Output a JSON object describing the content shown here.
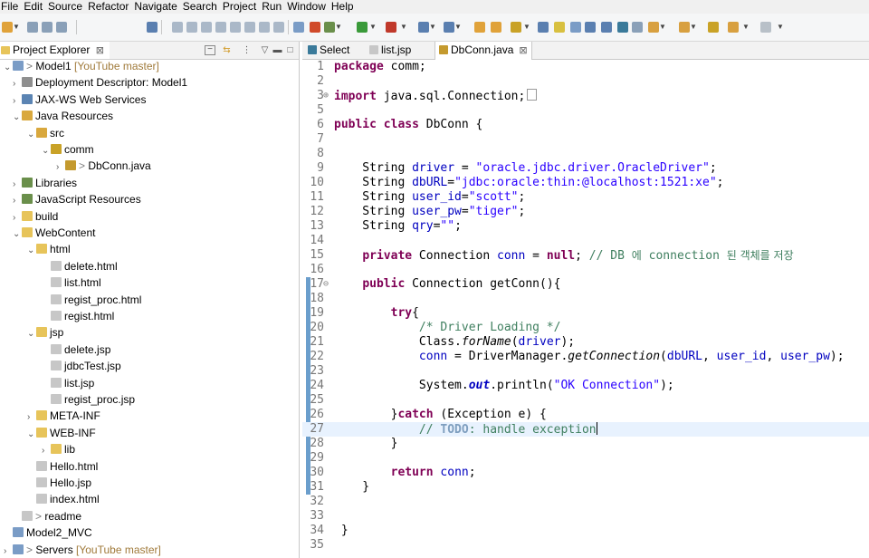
{
  "menu": [
    "File",
    "Edit",
    "Source",
    "Refactor",
    "Navigate",
    "Search",
    "Project",
    "Run",
    "Window",
    "Help"
  ],
  "explorer": {
    "title": "Project Explorer",
    "tree": [
      {
        "name": "Model1",
        "decoration": "[YouTube master]",
        "prefix": "> ",
        "twisty": "v",
        "icon": "project-icon",
        "color": "#7a9cc6"
      },
      {
        "name": "Deployment Descriptor: Model1",
        "decoration": "",
        "prefix": "",
        "twisty": ">",
        "icon": "deployment-descriptor-icon",
        "color": "#8f8f8f"
      },
      {
        "name": "JAX-WS Web Services",
        "decoration": "",
        "prefix": "",
        "twisty": ">",
        "icon": "web-services-icon",
        "color": "#5b84b3"
      },
      {
        "name": "Java Resources",
        "decoration": "",
        "prefix": "",
        "twisty": "v",
        "icon": "java-resources-icon",
        "color": "#d9a83d"
      },
      {
        "name": "src",
        "decoration": "",
        "prefix": "",
        "twisty": "v",
        "icon": "source-folder-icon",
        "color": "#d9a83d"
      },
      {
        "name": "comm",
        "decoration": "",
        "prefix": "",
        "twisty": "v",
        "icon": "package-icon",
        "color": "#c9a227"
      },
      {
        "name": "DbConn.java",
        "decoration": "",
        "prefix": "> ",
        "twisty": ">",
        "icon": "java-file-icon",
        "color": "#c49a2e"
      },
      {
        "name": "Libraries",
        "decoration": "",
        "prefix": "",
        "twisty": ">",
        "icon": "libraries-icon",
        "color": "#6a8f4b"
      },
      {
        "name": "JavaScript Resources",
        "decoration": "",
        "prefix": "",
        "twisty": ">",
        "icon": "javascript-resources-icon",
        "color": "#6a8f4b"
      },
      {
        "name": "build",
        "decoration": "",
        "prefix": "",
        "twisty": ">",
        "icon": "folder-icon",
        "color": "#e7c45a"
      },
      {
        "name": "WebContent",
        "decoration": "",
        "prefix": "",
        "twisty": "v",
        "icon": "folder-icon",
        "color": "#e7c45a"
      },
      {
        "name": "html",
        "decoration": "",
        "prefix": "",
        "twisty": "v",
        "icon": "folder-icon",
        "color": "#e7c45a"
      },
      {
        "name": "delete.html",
        "decoration": "",
        "prefix": "",
        "twisty": "",
        "icon": "file-icon",
        "color": "#c7c7c7"
      },
      {
        "name": "list.html",
        "decoration": "",
        "prefix": "",
        "twisty": "",
        "icon": "file-icon",
        "color": "#c7c7c7"
      },
      {
        "name": "regist_proc.html",
        "decoration": "",
        "prefix": "",
        "twisty": "",
        "icon": "file-icon",
        "color": "#c7c7c7"
      },
      {
        "name": "regist.html",
        "decoration": "",
        "prefix": "",
        "twisty": "",
        "icon": "file-icon",
        "color": "#c7c7c7"
      },
      {
        "name": "jsp",
        "decoration": "",
        "prefix": "",
        "twisty": "v",
        "icon": "folder-icon",
        "color": "#e7c45a"
      },
      {
        "name": "delete.jsp",
        "decoration": "",
        "prefix": "",
        "twisty": "",
        "icon": "file-icon",
        "color": "#c7c7c7"
      },
      {
        "name": "jdbcTest.jsp",
        "decoration": "",
        "prefix": "",
        "twisty": "",
        "icon": "file-icon",
        "color": "#c7c7c7"
      },
      {
        "name": "list.jsp",
        "decoration": "",
        "prefix": "",
        "twisty": "",
        "icon": "file-icon",
        "color": "#c7c7c7"
      },
      {
        "name": "regist_proc.jsp",
        "decoration": "",
        "prefix": "",
        "twisty": "",
        "icon": "file-icon",
        "color": "#c7c7c7"
      },
      {
        "name": "META-INF",
        "decoration": "",
        "prefix": "",
        "twisty": ">",
        "icon": "folder-icon",
        "color": "#e7c45a"
      },
      {
        "name": "WEB-INF",
        "decoration": "",
        "prefix": "",
        "twisty": "v",
        "icon": "folder-icon",
        "color": "#e7c45a"
      },
      {
        "name": "lib",
        "decoration": "",
        "prefix": "",
        "twisty": ">",
        "icon": "folder-icon",
        "color": "#e7c45a"
      },
      {
        "name": "Hello.html",
        "decoration": "",
        "prefix": "",
        "twisty": "",
        "icon": "file-icon",
        "color": "#c7c7c7"
      },
      {
        "name": "Hello.jsp",
        "decoration": "",
        "prefix": "",
        "twisty": "",
        "icon": "file-icon",
        "color": "#c7c7c7"
      },
      {
        "name": "index.html",
        "decoration": "",
        "prefix": "",
        "twisty": "",
        "icon": "file-icon",
        "color": "#c7c7c7"
      },
      {
        "name": "readme",
        "decoration": "",
        "prefix": "> ",
        "twisty": "",
        "icon": "file-icon",
        "color": "#c7c7c7"
      },
      {
        "name": "Model2_MVC",
        "decoration": "",
        "prefix": "",
        "twisty": "",
        "icon": "closed-project-icon",
        "color": "#7a9cc6"
      },
      {
        "name": "Servers",
        "decoration": "[YouTube master]",
        "prefix": "> ",
        "twisty": ">",
        "icon": "servers-project-icon",
        "color": "#7a9cc6"
      }
    ]
  },
  "editor": {
    "tabs": [
      {
        "label": "Select",
        "icon": "web-browser-icon",
        "active": false
      },
      {
        "label": "list.jsp",
        "icon": "jsp-file-icon",
        "active": false
      },
      {
        "label": "DbConn.java",
        "icon": "java-file-icon",
        "active": true
      }
    ],
    "close_glyph": "⊠",
    "current_line": 27,
    "lines": [
      {
        "n": "1",
        "tokens": [
          {
            "t": "package",
            "c": "kw"
          },
          {
            "t": " comm;"
          }
        ]
      },
      {
        "n": "2",
        "tokens": []
      },
      {
        "n": "3",
        "fold": "⊕",
        "tokens": [
          {
            "t": "import",
            "c": "kw"
          },
          {
            "t": " java.sql.Connection;"
          }
        ],
        "collapsed": true
      },
      {
        "n": "5",
        "tokens": []
      },
      {
        "n": "6",
        "tokens": [
          {
            "t": "public",
            "c": "kw"
          },
          {
            "t": " "
          },
          {
            "t": "class",
            "c": "kw"
          },
          {
            "t": " DbConn {"
          }
        ]
      },
      {
        "n": "7",
        "tokens": []
      },
      {
        "n": "8",
        "tokens": []
      },
      {
        "n": "9",
        "tokens": [
          {
            "t": "    String "
          },
          {
            "t": "driver",
            "c": "fld"
          },
          {
            "t": " = "
          },
          {
            "t": "\"oracle.jdbc.driver.OracleDriver\"",
            "c": "str"
          },
          {
            "t": ";"
          }
        ]
      },
      {
        "n": "10",
        "tokens": [
          {
            "t": "    String "
          },
          {
            "t": "dbURL",
            "c": "fld"
          },
          {
            "t": "="
          },
          {
            "t": "\"jdbc:oracle:thin:@localhost:1521:xe\"",
            "c": "str"
          },
          {
            "t": ";"
          }
        ]
      },
      {
        "n": "11",
        "tokens": [
          {
            "t": "    String "
          },
          {
            "t": "user_id",
            "c": "fld"
          },
          {
            "t": "="
          },
          {
            "t": "\"scott\"",
            "c": "str"
          },
          {
            "t": ";"
          }
        ]
      },
      {
        "n": "12",
        "tokens": [
          {
            "t": "    String "
          },
          {
            "t": "user_pw",
            "c": "fld"
          },
          {
            "t": "="
          },
          {
            "t": "\"tiger\"",
            "c": "str"
          },
          {
            "t": ";"
          }
        ]
      },
      {
        "n": "13",
        "tokens": [
          {
            "t": "    String "
          },
          {
            "t": "qry",
            "c": "fld"
          },
          {
            "t": "="
          },
          {
            "t": "\"\"",
            "c": "str"
          },
          {
            "t": ";"
          }
        ]
      },
      {
        "n": "14",
        "tokens": []
      },
      {
        "n": "15",
        "tokens": [
          {
            "t": "    "
          },
          {
            "t": "private",
            "c": "kw"
          },
          {
            "t": " Connection "
          },
          {
            "t": "conn",
            "c": "fld"
          },
          {
            "t": " = "
          },
          {
            "t": "null",
            "c": "kw"
          },
          {
            "t": "; "
          },
          {
            "t": "// DB ",
            "c": "cmt"
          },
          {
            "t": "에",
            "c": "cmt ko"
          },
          {
            "t": " connection ",
            "c": "cmt"
          },
          {
            "t": "된 객체를 저장",
            "c": "cmt ko"
          }
        ]
      },
      {
        "n": "16",
        "tokens": []
      },
      {
        "n": "17",
        "fold": "⊖",
        "tokens": [
          {
            "t": "    "
          },
          {
            "t": "public",
            "c": "kw"
          },
          {
            "t": " Connection getConn(){"
          }
        ],
        "marker": true
      },
      {
        "n": "18",
        "tokens": [],
        "marker": true
      },
      {
        "n": "19",
        "tokens": [
          {
            "t": "        "
          },
          {
            "t": "try",
            "c": "kw"
          },
          {
            "t": "{"
          }
        ],
        "marker": true
      },
      {
        "n": "20",
        "tokens": [
          {
            "t": "            "
          },
          {
            "t": "/* Driver Loading */",
            "c": "cmt"
          }
        ],
        "marker": true
      },
      {
        "n": "21",
        "tokens": [
          {
            "t": "            Class."
          },
          {
            "t": "forName",
            "c": "it"
          },
          {
            "t": "("
          },
          {
            "t": "driver",
            "c": "fld"
          },
          {
            "t": ");"
          }
        ],
        "marker": true
      },
      {
        "n": "22",
        "tokens": [
          {
            "t": "            "
          },
          {
            "t": "conn",
            "c": "fld"
          },
          {
            "t": " = DriverManager."
          },
          {
            "t": "getConnection",
            "c": "it"
          },
          {
            "t": "("
          },
          {
            "t": "dbURL",
            "c": "fld"
          },
          {
            "t": ", "
          },
          {
            "t": "user_id",
            "c": "fld"
          },
          {
            "t": ", "
          },
          {
            "t": "user_pw",
            "c": "fld"
          },
          {
            "t": ");"
          }
        ],
        "marker": true
      },
      {
        "n": "23",
        "tokens": [],
        "marker": true
      },
      {
        "n": "24",
        "tokens": [
          {
            "t": "            System."
          },
          {
            "t": "out",
            "c": "stat"
          },
          {
            "t": ".println("
          },
          {
            "t": "\"OK Connection\"",
            "c": "str"
          },
          {
            "t": ");"
          }
        ],
        "marker": true
      },
      {
        "n": "25",
        "tokens": [],
        "marker": true
      },
      {
        "n": "26",
        "tokens": [
          {
            "t": "        }"
          },
          {
            "t": "catch",
            "c": "kw"
          },
          {
            "t": " (Exception e) {"
          }
        ],
        "marker": true
      },
      {
        "n": "27",
        "tokens": [
          {
            "t": "            "
          },
          {
            "t": "// ",
            "c": "cmt"
          },
          {
            "t": "TODO",
            "c": "todo"
          },
          {
            "t": ": handle exception",
            "c": "cmt"
          }
        ],
        "marker": true,
        "caret": true
      },
      {
        "n": "28",
        "tokens": [
          {
            "t": "        }"
          }
        ],
        "marker": true
      },
      {
        "n": "29",
        "tokens": [],
        "marker": true
      },
      {
        "n": "30",
        "tokens": [
          {
            "t": "        "
          },
          {
            "t": "return",
            "c": "kw"
          },
          {
            "t": " "
          },
          {
            "t": "conn",
            "c": "fld"
          },
          {
            "t": ";"
          }
        ],
        "marker": true
      },
      {
        "n": "31",
        "tokens": [
          {
            "t": "    }"
          }
        ],
        "marker": true
      },
      {
        "n": "32",
        "tokens": []
      },
      {
        "n": "33",
        "tokens": []
      },
      {
        "n": "34",
        "tokens": [
          {
            "t": " }"
          }
        ]
      },
      {
        "n": "35",
        "tokens": []
      }
    ]
  },
  "colors": {
    "keyword": "#7f0055",
    "string": "#2a00ff",
    "field": "#0000c0",
    "comment": "#3f7f5f",
    "current_line": "#e8f2fe",
    "marker": "#6b9ecc"
  }
}
